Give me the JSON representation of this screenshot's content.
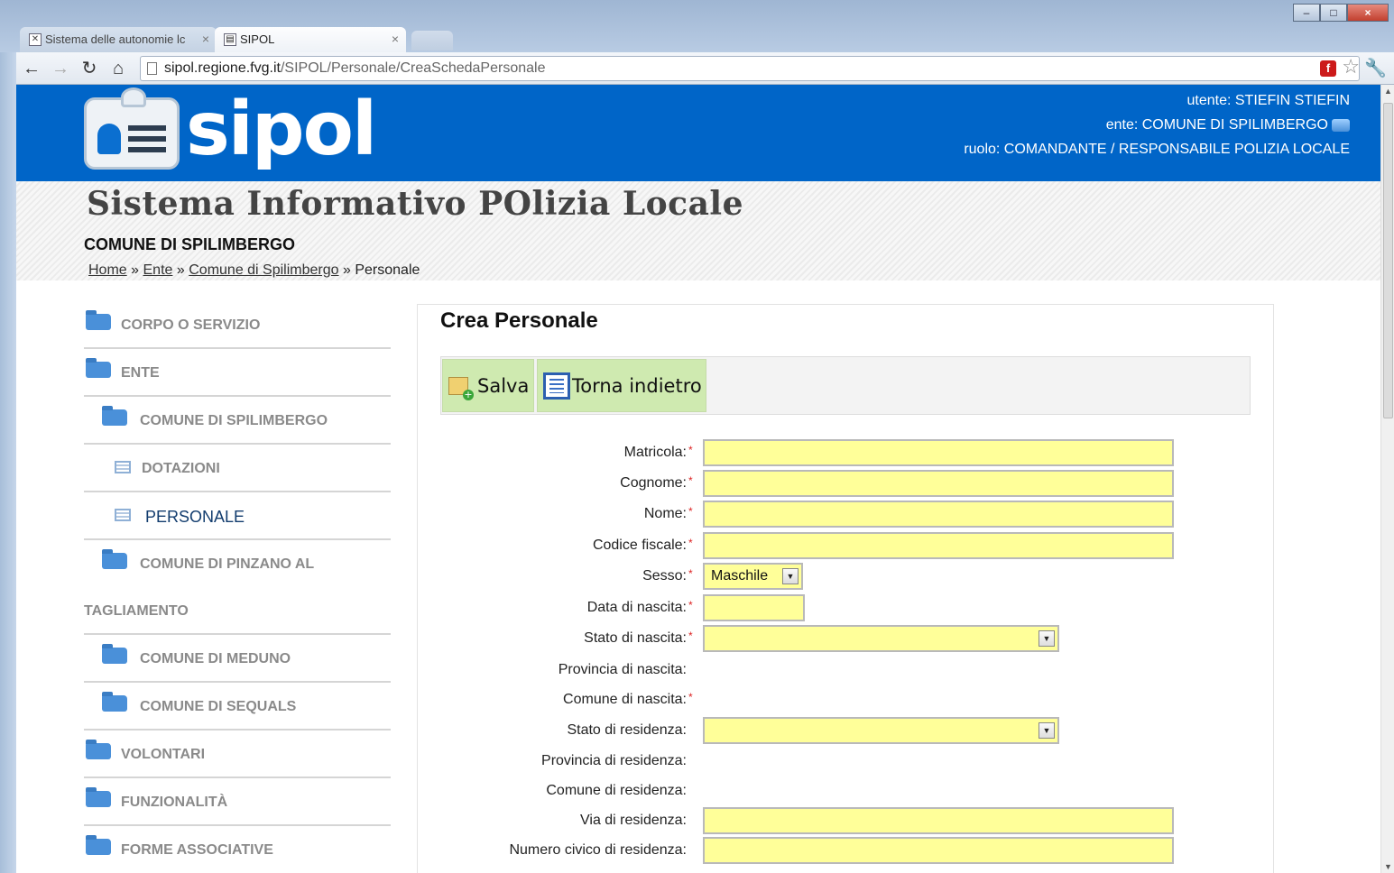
{
  "browser": {
    "tabs": [
      {
        "label": "Sistema delle autonomie lc",
        "active": false
      },
      {
        "label": "SIPOL",
        "active": true
      }
    ],
    "url_host": "sipol.regione.fvg.it",
    "url_path": "/SIPOL/Personale/CreaSchedaPersonale"
  },
  "header": {
    "logo_text": "sipol",
    "utente": "utente: STIEFIN STIEFIN",
    "ente": "ente: COMUNE DI SPILIMBERGO",
    "ruolo": "ruolo: COMANDANTE / RESPONSABILE POLIZIA LOCALE",
    "color": "#0065c8"
  },
  "site": {
    "title": "Sistema Informativo POlizia Locale",
    "comune": "COMUNE DI SPILIMBERGO"
  },
  "breadcrumb": {
    "home": "Home",
    "sep": "»",
    "ente": "Ente",
    "comune": "Comune di Spilimbergo",
    "current": "Personale"
  },
  "sidebar": {
    "items": [
      {
        "label": "CORPO O SERVIZIO",
        "icon": "folder-icon"
      },
      {
        "label": "ENTE",
        "icon": "folder-icon"
      },
      {
        "label": "COMUNE DI SPILIMBERGO",
        "icon": "folder-icon"
      },
      {
        "label": "DOTAZIONI",
        "icon": "list-icon"
      },
      {
        "label": "PERSONALE",
        "icon": "list-icon",
        "active": true
      },
      {
        "label": "COMUNE DI PINZANO AL",
        "label2": "TAGLIAMENTO",
        "icon": "folder-icon"
      },
      {
        "label": "COMUNE DI MEDUNO",
        "icon": "folder-icon"
      },
      {
        "label": "COMUNE DI SEQUALS",
        "icon": "folder-icon"
      },
      {
        "label": "VOLONTARI",
        "icon": "folder-icon"
      },
      {
        "label": "FUNZIONALITÀ",
        "icon": "folder-icon"
      },
      {
        "label": "FORME ASSOCIATIVE",
        "icon": "folder-icon"
      }
    ]
  },
  "main": {
    "title": "Crea Personale",
    "actions": {
      "save": "Salva",
      "back": "Torna indietro"
    },
    "required_mark": "*",
    "fields": [
      {
        "label": "Matricola:",
        "required": true,
        "value": ""
      },
      {
        "label": "Cognome:",
        "required": true,
        "value": ""
      },
      {
        "label": "Nome:",
        "required": true,
        "value": ""
      },
      {
        "label": "Codice fiscale:",
        "required": true,
        "value": ""
      },
      {
        "label": "Sesso:",
        "required": true,
        "value": "Maschile"
      },
      {
        "label": "Data di nascita:",
        "required": true,
        "value": ""
      },
      {
        "label": "Stato di nascita:",
        "required": true,
        "value": ""
      },
      {
        "label": "Provincia di nascita:",
        "required": false
      },
      {
        "label": "Comune di nascita:",
        "required": true
      },
      {
        "label": "Stato di residenza:",
        "required": false,
        "value": ""
      },
      {
        "label": "Provincia di residenza:",
        "required": false
      },
      {
        "label": "Comune di residenza:",
        "required": false
      },
      {
        "label": "Via di residenza:",
        "required": false,
        "value": ""
      },
      {
        "label": "Numero civico di residenza:",
        "required": false,
        "value": ""
      }
    ],
    "field_color": "#ffff99"
  }
}
